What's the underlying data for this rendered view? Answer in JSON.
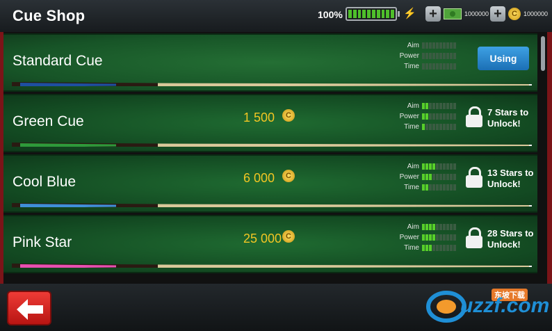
{
  "header": {
    "title": "Cue Shop",
    "battery_percent": "100%",
    "cash_amount": "1000000",
    "coin_amount": "1000000",
    "coin_glyph": "C"
  },
  "cues": [
    {
      "name": "Standard Cue",
      "price": "",
      "status": "Using",
      "aim": 0,
      "power": 0,
      "time": 0,
      "colors": {
        "butt": "#1e4fa0",
        "shaft": "#d9c89a"
      }
    },
    {
      "name": "Green Cue",
      "price": "1 500",
      "unlock": "7 Stars to Unlock!",
      "aim": 2,
      "power": 2,
      "time": 1,
      "colors": {
        "butt": "#2e9a3a",
        "shaft": "#d9c89a"
      }
    },
    {
      "name": "Cool Blue",
      "price": "6 000",
      "unlock": "13 Stars to Unlock!",
      "aim": 4,
      "power": 3,
      "time": 2,
      "colors": {
        "butt": "#3f8fd8",
        "shaft": "#d9c89a"
      }
    },
    {
      "name": "Pink Star",
      "price": "25 000",
      "unlock": "28 Stars to Unlock!",
      "aim": 4,
      "power": 4,
      "time": 3,
      "colors": {
        "butt": "#e84fb0",
        "shaft": "#d9c89a"
      }
    }
  ],
  "stat_labels": {
    "aim": "Aim",
    "power": "Power",
    "time": "Time"
  },
  "footer": {
    "back_icon": "arrow-left-icon",
    "logo_text": "uzzf.com",
    "logo_badge": "东坡下载"
  }
}
